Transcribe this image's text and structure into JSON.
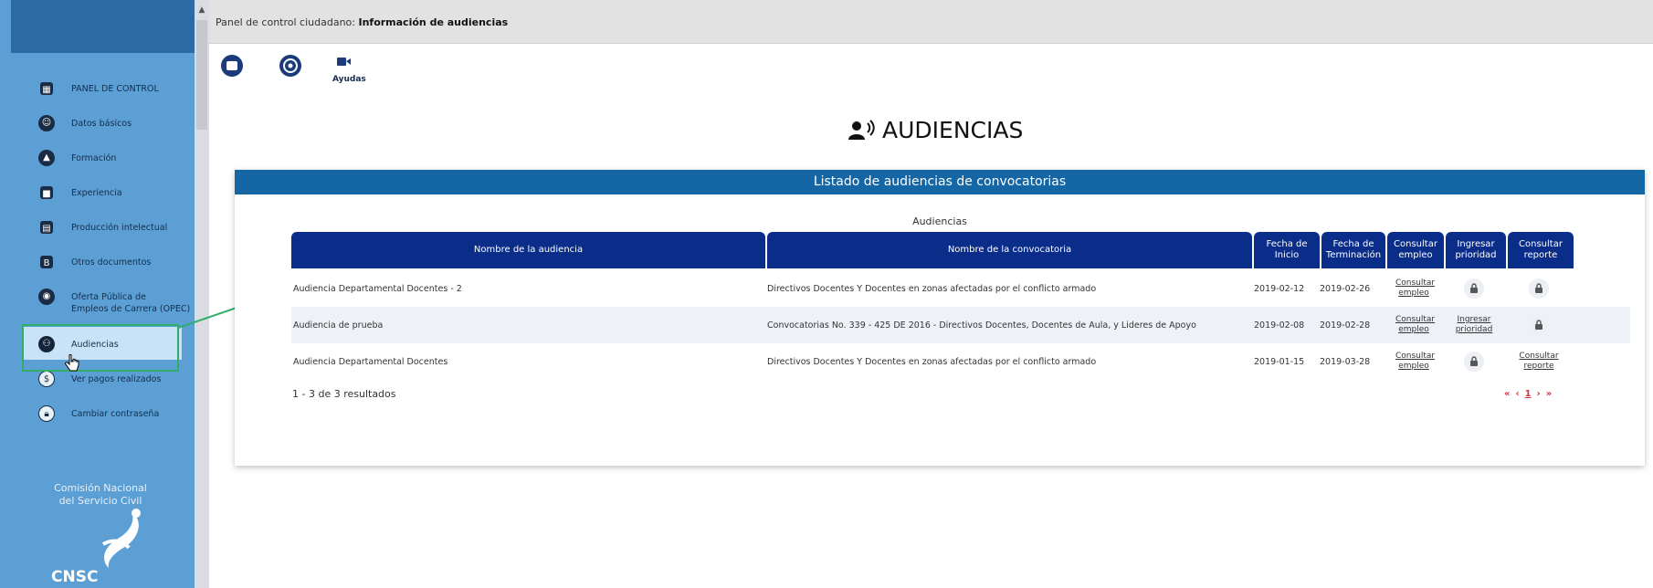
{
  "header": {
    "prefix": "Panel de control ciudadano: ",
    "title": "Información de audiencias"
  },
  "toolbar": {
    "help_label": "Ayudas"
  },
  "page": {
    "title": "AUDIENCIAS"
  },
  "sidebar": {
    "items": [
      {
        "label": "PANEL DE CONTROL",
        "icon": "grid-icon"
      },
      {
        "label": "Datos básicos",
        "icon": "user-icon"
      },
      {
        "label": "Formación",
        "icon": "graduation-icon"
      },
      {
        "label": "Experiencia",
        "icon": "briefcase-icon"
      },
      {
        "label": "Producción intelectual",
        "icon": "book-icon"
      },
      {
        "label": "Otros documentos",
        "icon": "document-icon"
      },
      {
        "label": "Oferta Pública de",
        "label2": "Empleos de Carrera (OPEC)",
        "icon": "globe-icon"
      },
      {
        "label": "Audiencias",
        "icon": "audience-icon"
      },
      {
        "label": "Ver pagos realizados",
        "icon": "dollar-icon"
      },
      {
        "label": "Cambiar contraseña",
        "icon": "lock-icon"
      }
    ],
    "brand_line1": "Comisión Nacional",
    "brand_line2": "del Servicio Civil",
    "brand_short": "CNSC"
  },
  "card": {
    "heading": "Listado de audiencias de convocatorias",
    "caption": "Audiencias",
    "columns": [
      "Nombre de la audiencia",
      "Nombre de la convocatoria",
      "Fecha de Inicio",
      "Fecha de Terminación",
      "Consultar empleo",
      "Ingresar prioridad",
      "Consultar reporte"
    ],
    "rows": [
      {
        "audiencia": "Audiencia Departamental Docentes - 2",
        "convocatoria": "Directivos Docentes Y Docentes en zonas afectadas por el conflicto armado",
        "inicio": "2019-02-12",
        "fin": "2019-02-26",
        "empleo": "Consultar empleo",
        "prioridad": "",
        "reporte": ""
      },
      {
        "audiencia": "Audiencia de prueba",
        "convocatoria": "Convocatorias No. 339 - 425 DE 2016 - Directivos Docentes, Docentes de Aula, y Lideres de Apoyo",
        "inicio": "2019-02-08",
        "fin": "2019-02-28",
        "empleo": "Consultar empleo",
        "prioridad": "Ingresar prioridad",
        "reporte": ""
      },
      {
        "audiencia": "Audiencia Departamental Docentes",
        "convocatoria": "Directivos Docentes Y Docentes en zonas afectadas por el conflicto armado",
        "inicio": "2019-01-15",
        "fin": "2019-03-28",
        "empleo": "Consultar empleo",
        "prioridad": "",
        "reporte": "Consultar reporte"
      }
    ],
    "results_text": "1 - 3 de 3 resultados",
    "pager": {
      "first": "«",
      "prev": "‹",
      "current": "1",
      "next": "›",
      "last": "»"
    }
  },
  "colors": {
    "sidebar": "#5b9fd4",
    "header_bar": "#1466a4",
    "table_header": "#0b2d8a",
    "pager": "#d6303a",
    "highlight": "#2fae6a"
  }
}
